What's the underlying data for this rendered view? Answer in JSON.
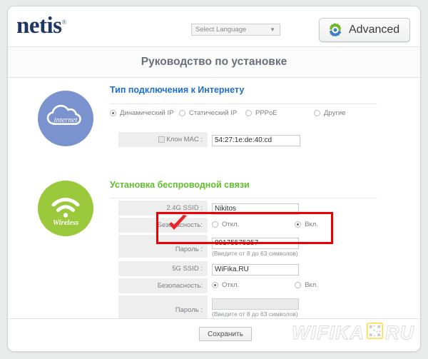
{
  "header": {
    "logo": "netis",
    "logo_mark": "®",
    "language_select": "Select Language",
    "language_caret": "▼",
    "advanced_label": "Advanced",
    "gear_icon": "gear-icon"
  },
  "page_title": "Руководство по установке",
  "internet": {
    "badge_label": "internet",
    "section_title": "Тип подключения к Интернету",
    "connection_types": [
      {
        "label": "Динамический IP",
        "selected": true
      },
      {
        "label": "Статический IP",
        "selected": false
      },
      {
        "label": "PPPoE",
        "selected": false
      },
      {
        "label": "Другие",
        "selected": false
      }
    ],
    "mac_clone": {
      "label": "Клон MAC :",
      "checked": true,
      "value": "54:27:1e:de:40:cd",
      "annotation": "red-checkmark"
    }
  },
  "wireless": {
    "badge_label": "Wireless",
    "section_title": "Установка беспроводной связи",
    "bands": [
      {
        "ssid_label": "2.4G SSID :",
        "ssid_value": "Nikitos",
        "security_label": "Безопасность:",
        "security_off": "Откл.",
        "security_on": "Вкл.",
        "security_selected": "on",
        "password_label": "Пароль :",
        "password_value": "89175575257",
        "password_hint": "(Введите от 8 до 63 символов)",
        "password_disabled": false
      },
      {
        "ssid_label": "5G SSID :",
        "ssid_value": "WiFika.RU",
        "security_label": "Безопасность:",
        "security_off": "Откл.",
        "security_on": "Вкл.",
        "security_selected": "off",
        "password_label": "Пароль :",
        "password_value": "",
        "password_hint": "(Введите от 8 до 63 символов)",
        "password_disabled": true
      }
    ]
  },
  "footer": {
    "save_label": "Сохранить",
    "watermark_left": "WIFIKA",
    "watermark_right": "RU",
    "watermark_qr_icon": "qr-code-icon"
  },
  "colors": {
    "logo": "#1c3763",
    "internet_blue": "#7a93cf",
    "wireless_green": "#9ac93c",
    "section_blue": "#1c6fd0",
    "section_green": "#5fc02a",
    "highlight_red": "#ee0000",
    "watermark_yellow": "#ffd92e"
  }
}
